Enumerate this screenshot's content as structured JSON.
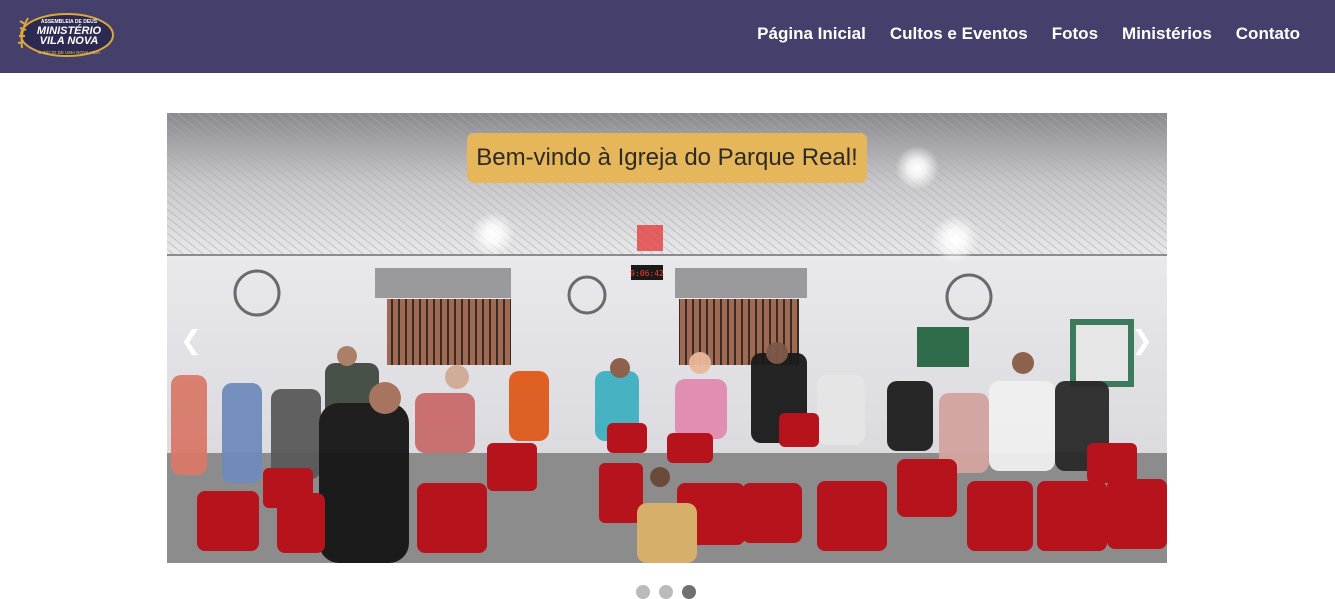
{
  "logo": {
    "line1": "ASSEMBLEIA DE DEUS",
    "line2": "MINISTÉRIO",
    "line3": "VILA NOVA",
    "line4": "O INÍCIO DE UMA NOVA VIDA"
  },
  "nav": {
    "items": [
      "Página Inicial",
      "Cultos e Eventos",
      "Fotos",
      "Ministérios",
      "Contato"
    ]
  },
  "slideshow": {
    "caption": "Bem-vindo à Igreja do Parque Real!",
    "prev": "❮",
    "next": "❯",
    "clock": "9:06:42",
    "slide_count": 3,
    "active_slide": 3
  },
  "colors": {
    "header_bg": "#453f6b",
    "caption_bg": "#e6b65b",
    "chair_red": "#c0141d"
  }
}
